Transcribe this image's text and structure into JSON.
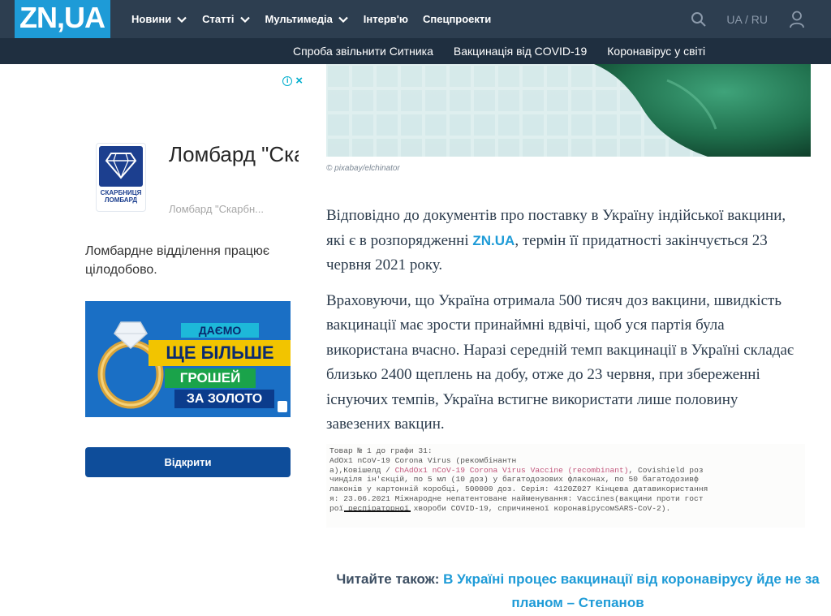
{
  "header": {
    "logo_text": "ZN,UA",
    "nav": [
      {
        "label": "Новини",
        "has_dropdown": true
      },
      {
        "label": "Статті",
        "has_dropdown": true
      },
      {
        "label": "Мультимедіа",
        "has_dropdown": true
      },
      {
        "label": "Інтерв'ю",
        "has_dropdown": false
      },
      {
        "label": "Спецпроекти",
        "has_dropdown": false
      }
    ],
    "lang_switch": "UA / RU",
    "icons": {
      "search": "search-icon",
      "user": "user-icon"
    }
  },
  "subnav": [
    "Спроба звільнити Ситника",
    "Вакцинація від COVID-19",
    "Коронавірус у світі"
  ],
  "ad": {
    "title": "Ломбард \"Скарбн...",
    "subtitle": "Ломбард \"Скарбн...",
    "logo_text": "СКАРБНИЦЯ ЛОМБАРД",
    "description": "Ломбардне відділення працює цілодобово.",
    "banner_lines": [
      "ДАЄМО",
      "ЩЕ БІЛЬШЕ",
      "ГРОШЕЙ",
      "ЗА ЗОЛОТО"
    ],
    "cta": "Відкрити"
  },
  "article": {
    "image_credit": "© pixabay/elchinator",
    "p1_before": "Відповідно до документів про поставку в Україну індійської вакцини, які є в розпорядженні ",
    "p1_link": "ZN.UA",
    "p1_after": ", термін  її придатності закінчується 23 червня 2021 року.",
    "p2": "Враховуючи, що Україна отримала 500 тисяч доз вакцини, швидкість вакцинації має зрости принаймні вдвічі, щоб уся партія була використана вчасно. Наразі середній темп вакцинації в Україні складає близько 2400 щеплень на добу, отже до 23 червня, при збереженні існуючих темпів,  Україна встигне використати лише половину завезених вакцин.",
    "doc_lines": [
      "Товар № 1 до графи 31:",
      "AdOx1 nCoV-19 Corona Virus (рекомбінантн",
      "а),Ковішелд / ",
      "ChAdOx1 nCoV-19 Corona Virus Vaccine (recombinant)",
      ", Covishield роз",
      "чинділя ін'єкцій, по 5 мл (10 доз) у багатодозових флаконах, по 50 багатодозивф",
      "лаконів у картонній коробці, 500000 доз. Серія: 4120Z027 Кінцева датавикористання",
      "я: 23.06.2021 Міжнародне непатентоване найменування: Vaccines(вакцини проти гост",
      "рої респіраторної хвороби COVID-19, спричиненої коронавірусомSARS-CoV-2)."
    ],
    "read_also_label": "Читайте також:",
    "read_also_link": "В Україні процес вакцинації від коронавірусу йде не за планом – Степанов"
  },
  "colors": {
    "header_bg": "#2d3e50",
    "subbar_bg": "#1f2f40",
    "brand_blue": "#1e9bd7",
    "ad_button": "#0e4d9a"
  }
}
